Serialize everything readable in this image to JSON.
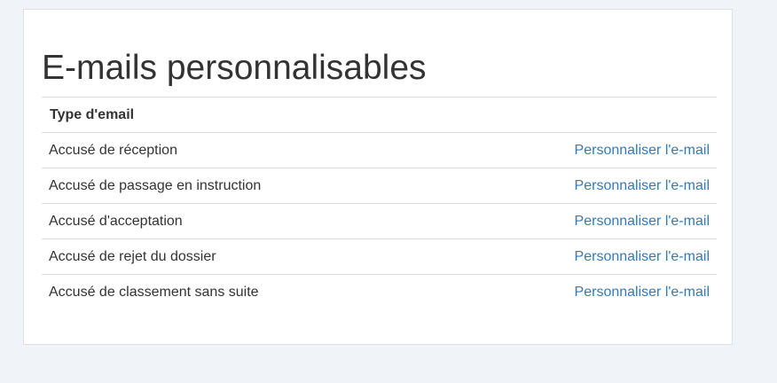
{
  "page": {
    "title": "E-mails personnalisables"
  },
  "table": {
    "header": "Type d'email",
    "rows": [
      {
        "type": "Accusé de réception",
        "action": "Personnaliser l'e-mail"
      },
      {
        "type": "Accusé de passage en instruction",
        "action": "Personnaliser l'e-mail"
      },
      {
        "type": "Accusé d'acceptation",
        "action": "Personnaliser l'e-mail"
      },
      {
        "type": "Accusé de rejet du dossier",
        "action": "Personnaliser l'e-mail"
      },
      {
        "type": "Accusé de classement sans suite",
        "action": "Personnaliser l'e-mail"
      }
    ]
  },
  "colors": {
    "link": "#337ab7",
    "text": "#333333",
    "page_background": "#f0f3f8"
  }
}
